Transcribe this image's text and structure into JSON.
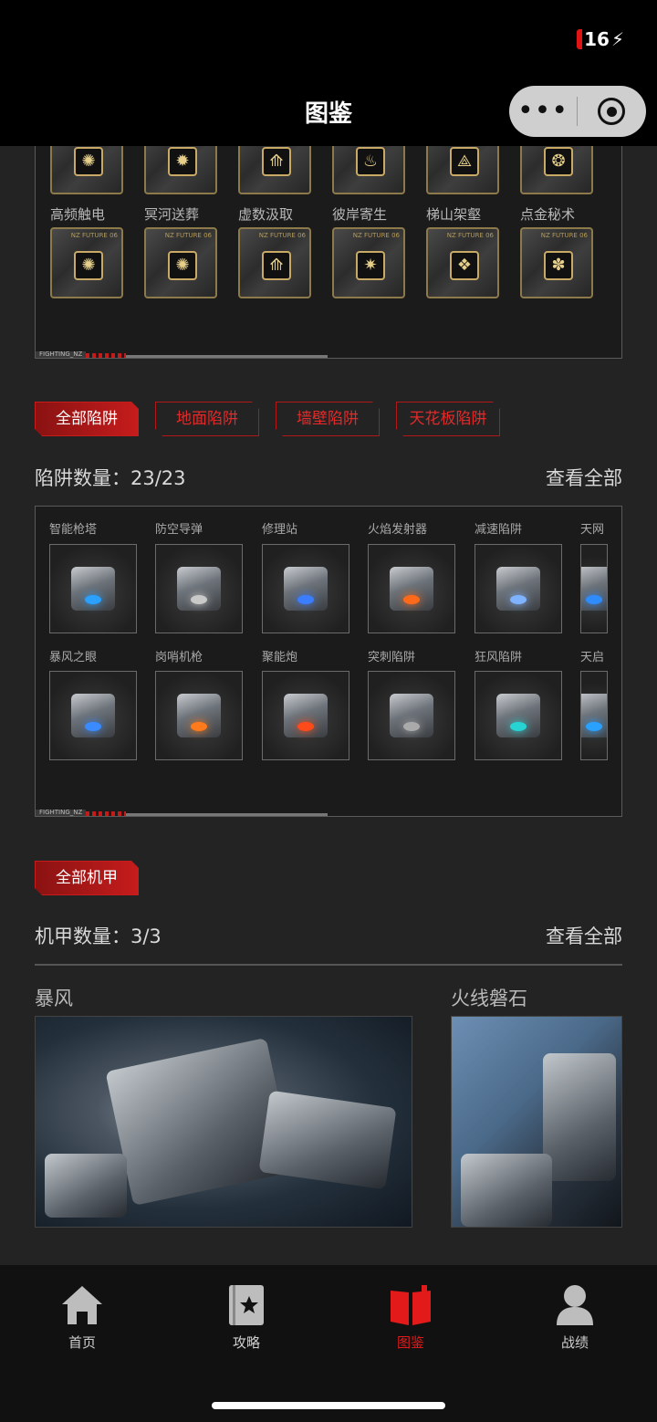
{
  "status": {
    "battery": "16"
  },
  "nav": {
    "title": "图鉴"
  },
  "chips": {
    "frame_tag": "FIGHTING_NZ",
    "row_names": [
      "高频触电",
      "冥河送葬",
      "虚数汲取",
      "彼岸寄生",
      "梯山架壑",
      "点金秘术"
    ],
    "tile_code": "NZ FUTURE 06",
    "glyphs": [
      "✺",
      "✹",
      "⟰",
      "♨",
      "⟁",
      "❂",
      "✺",
      "✺",
      "⟰",
      "✷",
      "❖",
      "✽"
    ]
  },
  "traps": {
    "tabs": [
      "全部陷阱",
      "地面陷阱",
      "墙壁陷阱",
      "天花板陷阱"
    ],
    "count_label": "陷阱数量：23/23",
    "view_all": "查看全部",
    "frame_tag": "FIGHTING_NZ",
    "row1": [
      "智能枪塔",
      "防空导弹",
      "修理站",
      "火焰发射器",
      "减速陷阱",
      "天网"
    ],
    "row2": [
      "暴风之眼",
      "岗哨机枪",
      "聚能炮",
      "突刺陷阱",
      "狂风陷阱",
      "天启"
    ],
    "accents": [
      "#2aa0ff",
      "#c9c9c9",
      "#3a7dff",
      "#ff6a1a",
      "#7fb2ff",
      "#2f8cff",
      "#3a8bff",
      "#ff7a1a",
      "#ff4a1a",
      "#aaaaaa",
      "#27d3d3",
      "#2aa0ff"
    ]
  },
  "mechs": {
    "tab": "全部机甲",
    "count_label": "机甲数量：3/3",
    "view_all": "查看全部",
    "items": [
      "暴风",
      "火线磐石"
    ]
  },
  "tabbar": {
    "items": [
      {
        "label": "首页",
        "icon": "home-icon"
      },
      {
        "label": "攻略",
        "icon": "guide-book-icon"
      },
      {
        "label": "图鉴",
        "icon": "open-book-icon"
      },
      {
        "label": "战绩",
        "icon": "user-icon"
      }
    ],
    "active_index": 2,
    "active_color": "#e21a1a"
  }
}
